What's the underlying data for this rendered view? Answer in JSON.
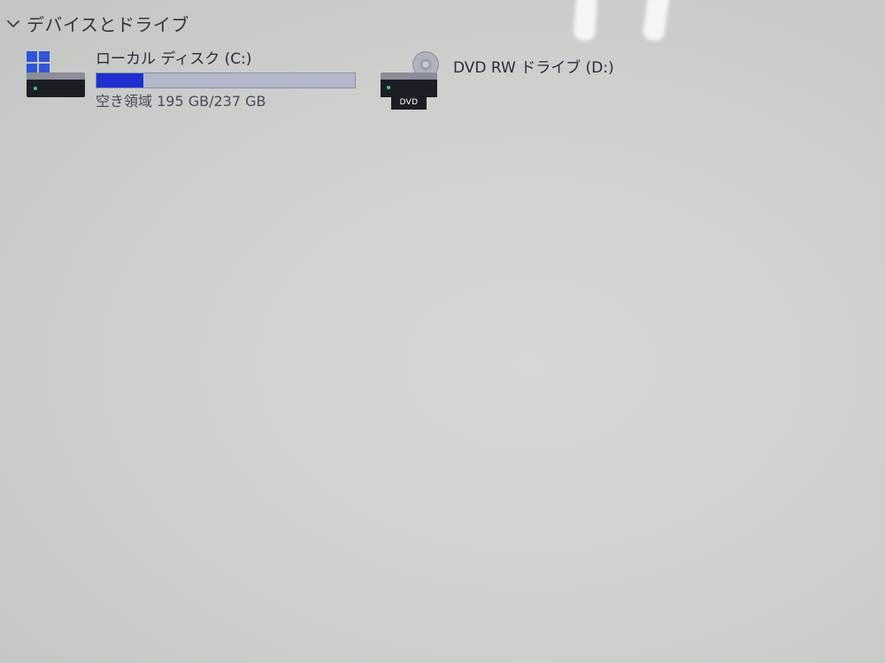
{
  "section": {
    "title": "デバイスとドライブ",
    "expanded": true,
    "chevron_icon": "chevron-down-icon"
  },
  "drives": {
    "c": {
      "name": "ローカル ディスク (C:)",
      "free_space": "空き領域 195 GB/237 GB",
      "used_fraction": 0.18,
      "icon": "windows-hdd-icon",
      "bar_fill_color": "#1f2fd0",
      "bar_track_color": "#b3b7c9"
    },
    "d": {
      "name": "DVD RW ドライブ (D:)",
      "icon": "dvd-drive-icon",
      "badge": "DVD"
    }
  }
}
